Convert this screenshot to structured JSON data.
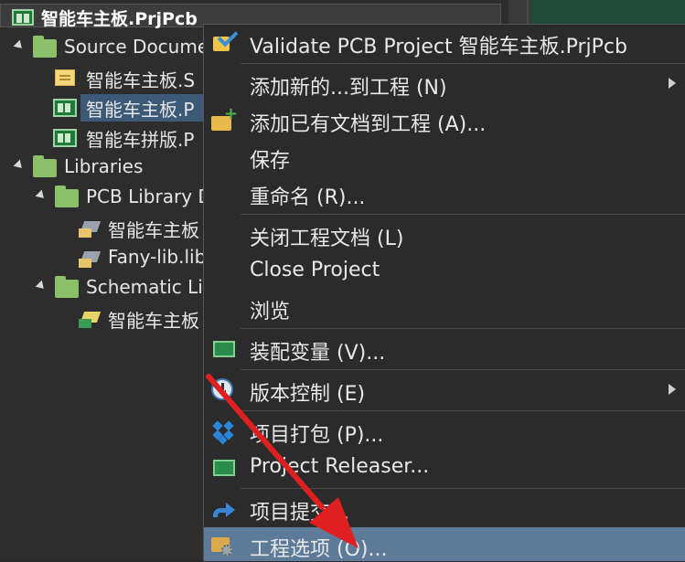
{
  "tree": {
    "project_title": "智能车主板.PrjPcb",
    "items": [
      {
        "label": "Source Docume",
        "level": 1,
        "type": "folder"
      },
      {
        "label": "智能车主板.S",
        "level": 2,
        "type": "schematic-doc"
      },
      {
        "label": "智能车主板.P",
        "level": 2,
        "type": "pcb-doc",
        "selected": true
      },
      {
        "label": "智能车拼版.P",
        "level": 2,
        "type": "pcb-doc"
      },
      {
        "label": "Libraries",
        "level": 1,
        "type": "folder"
      },
      {
        "label": "PCB Library D",
        "level": 2,
        "type": "folder"
      },
      {
        "label": "智能车主板",
        "level": 3,
        "type": "pcb-lib"
      },
      {
        "label": "Fany-lib.lib",
        "level": 3,
        "type": "pcb-lib"
      },
      {
        "label": "Schematic Lib",
        "level": 2,
        "type": "folder"
      },
      {
        "label": "智能车主板",
        "level": 3,
        "type": "sch-lib"
      }
    ]
  },
  "menu": {
    "items": [
      {
        "label": "Validate PCB Project 智能车主板.PrjPcb",
        "icon": "validate-icon"
      },
      {
        "label": "添加新的...到工程 (N)",
        "icon": "",
        "submenu": true
      },
      {
        "label": "添加已有文档到工程 (A)...",
        "icon": "add-existing-icon"
      },
      {
        "label": "保存",
        "icon": ""
      },
      {
        "label": "重命名 (R)...",
        "icon": ""
      },
      {
        "label": "关闭工程文档 (L)",
        "icon": ""
      },
      {
        "label": "Close Project",
        "icon": ""
      },
      {
        "label": "浏览",
        "icon": ""
      },
      {
        "label": "装配变量 (V)...",
        "icon": "board-icon"
      },
      {
        "label": "版本控制 (E)",
        "icon": "clock-icon",
        "submenu": true
      },
      {
        "label": "项目打包 (P)...",
        "icon": "dropbox-icon"
      },
      {
        "label": "Project Releaser...",
        "icon": "board-icon"
      },
      {
        "label": "项目提交...",
        "icon": "share-icon"
      },
      {
        "label": "工程选项 (O)...",
        "icon": "folder-gear-icon",
        "highlighted": true
      }
    ]
  },
  "colors": {
    "highlight": "#5d7a99",
    "selection": "#3c5a78",
    "arrow": "#e02020"
  }
}
